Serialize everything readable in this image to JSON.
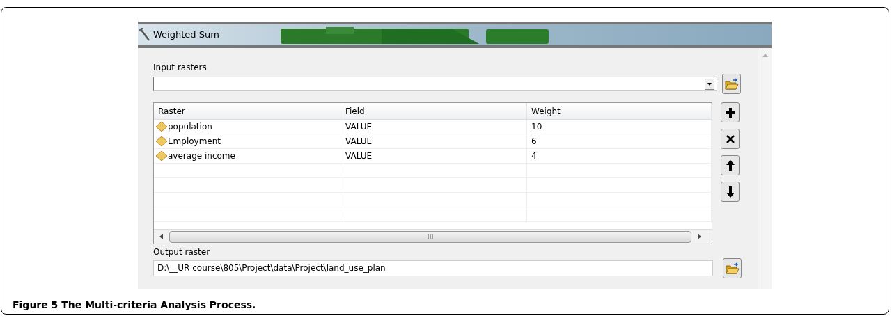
{
  "window": {
    "title": "Weighted Sum"
  },
  "input_rasters": {
    "label": "Input rasters"
  },
  "table": {
    "columns": [
      "Raster",
      "Field",
      "Weight"
    ],
    "rows": [
      [
        "population",
        "VALUE",
        "10"
      ],
      [
        "Employment",
        "VALUE",
        "6"
      ],
      [
        "average income",
        "VALUE",
        "4"
      ]
    ]
  },
  "output_raster": {
    "label": "Output raster",
    "value": "D:\\__UR course\\805\\Project\\data\\Project\\land_use_plan"
  },
  "caption": "Figure 5 The Multi-criteria Analysis Process."
}
